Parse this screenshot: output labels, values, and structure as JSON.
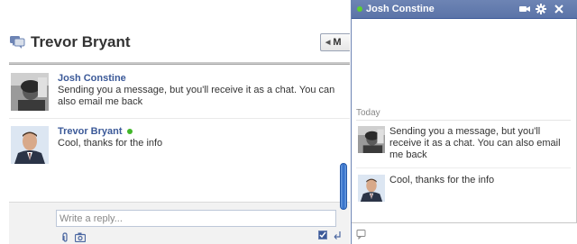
{
  "thread": {
    "title": "Trevor Bryant",
    "actions_label": "M"
  },
  "messages": [
    {
      "sender": "Josh Constine",
      "text": "Sending you a message, but you'll receive it as a chat. You can also email me back",
      "online": false
    },
    {
      "sender": "Trevor Bryant",
      "text": "Cool, thanks for the info",
      "online": true
    }
  ],
  "composer": {
    "placeholder": "Write a reply..."
  },
  "chat": {
    "contact_name": "Josh Constine",
    "day_label": "Today",
    "messages": [
      {
        "text": "Sending you a message, but you'll receive it as a chat. You can also email me back"
      },
      {
        "text": "Cool, thanks for the info"
      }
    ]
  },
  "icons": {
    "thread": "chat-bubbles-icon",
    "attach": "paperclip-icon",
    "camera": "camera-icon",
    "video": "video-camera-icon",
    "settings": "gear-icon",
    "close": "close-icon",
    "chat_input": "chat-bubble-icon"
  },
  "colors": {
    "brand_blue": "#3b5998",
    "chat_header": "#6d84b4",
    "online_green": "#42b72a"
  }
}
